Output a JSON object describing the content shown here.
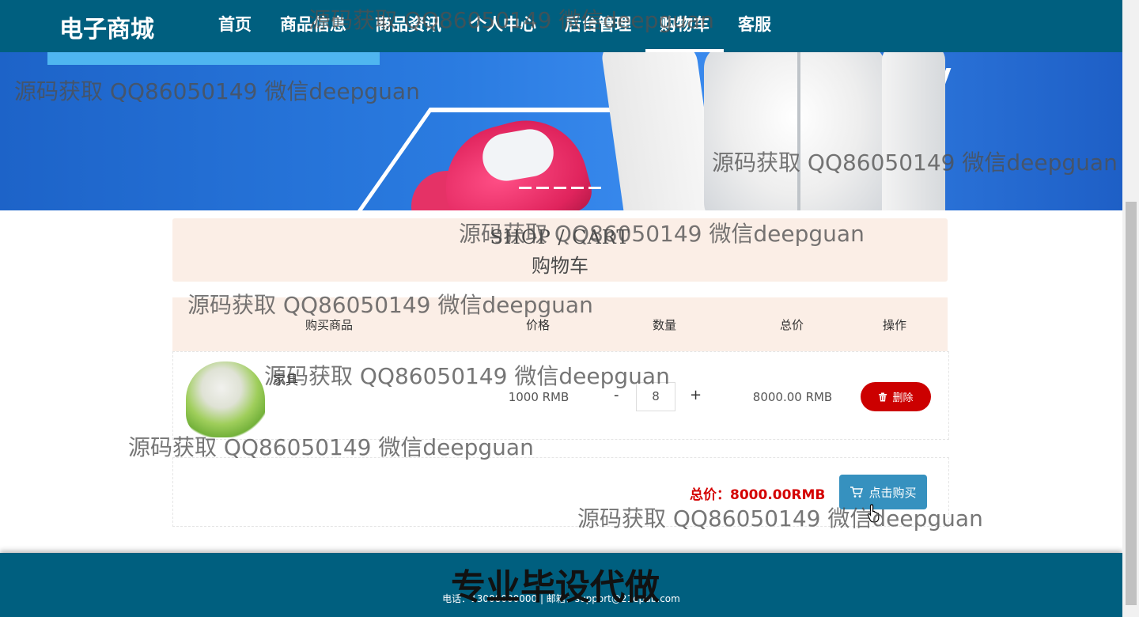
{
  "navbar": {
    "brand": "电子商城",
    "items": [
      {
        "label": "首页"
      },
      {
        "label": "商品信息"
      },
      {
        "label": "商品资讯"
      },
      {
        "label": "个人中心"
      },
      {
        "label": "后台管理"
      },
      {
        "label": "购物车",
        "active": true
      },
      {
        "label": "客服"
      }
    ]
  },
  "banner": {
    "slide_count": 5
  },
  "cart": {
    "title_en": "SHOP / CART",
    "title_cn": "购物车",
    "columns": [
      "购买商品",
      "价格",
      "数量",
      "总价",
      "操作"
    ],
    "items": [
      {
        "name": "家具",
        "price": "1000 RMB",
        "quantity": "8",
        "minus": "-",
        "plus": "+",
        "total": "8000.00 RMB",
        "delete_label": "删除"
      }
    ],
    "grand_total": "总价：8000.00RMB",
    "buy_label": "点击购买"
  },
  "footer": {
    "contact": "电话：13008000000 | 邮箱：support@21epub.com"
  },
  "watermarks": {
    "text": "源码获取 QQ86050149 微信deepguan",
    "big": "专业毕设代做"
  },
  "colors": {
    "nav_bg": "#005f7f",
    "title_bg": "#fbeee6",
    "delete": "#cc0000",
    "buy": "#3691bf",
    "total_text": "#d40000"
  }
}
